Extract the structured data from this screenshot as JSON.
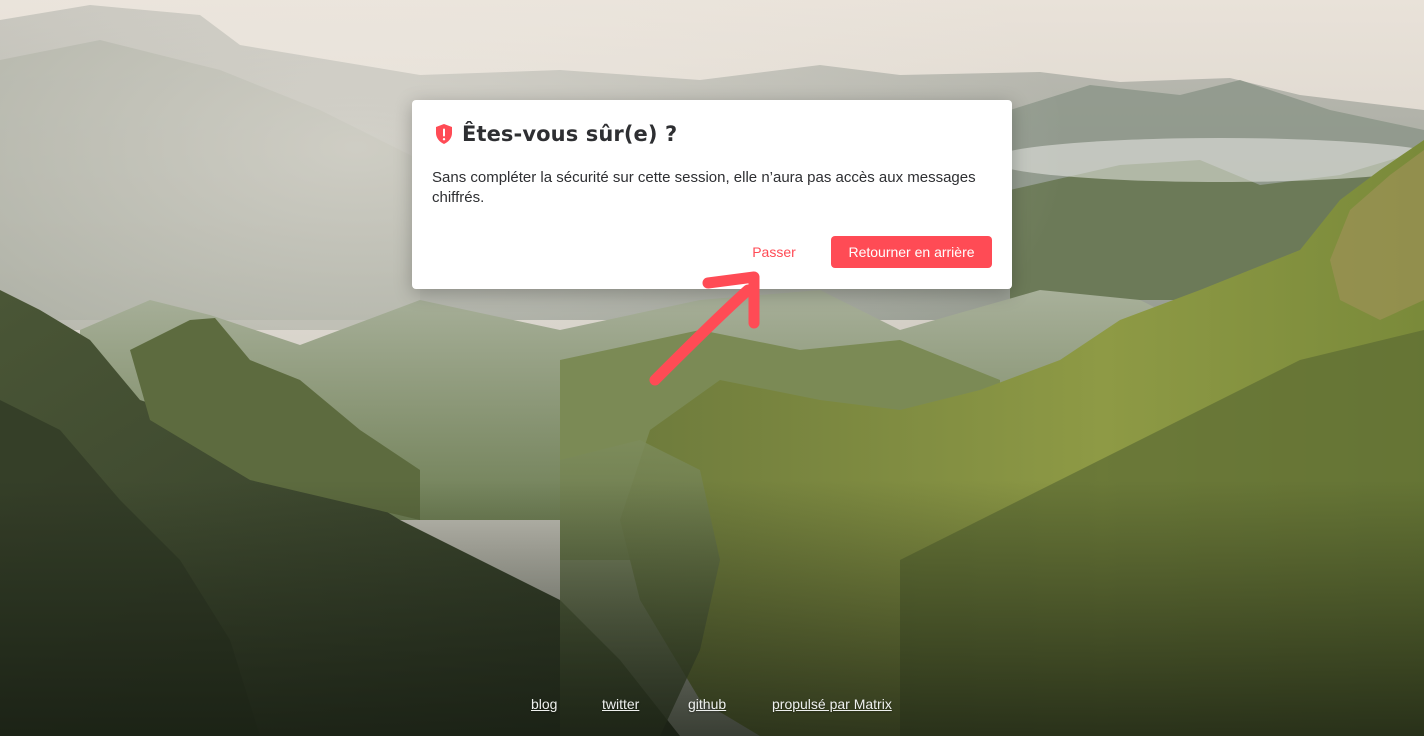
{
  "dialog": {
    "title": "Êtes-vous sûr(e) ?",
    "icon": "shield-warning-icon",
    "body": "Sans compléter la sécurité sur cette session, elle n’aura pas accès aux messages chiffrés.",
    "skip_label": "Passer",
    "back_label": "Retourner en arrière",
    "accent_color": "#ff4b55"
  },
  "annotation": {
    "icon": "red-arrow-annotation-icon",
    "color": "#ff4b55"
  },
  "footer": {
    "links": [
      {
        "label": "blog"
      },
      {
        "label": "twitter"
      },
      {
        "label": "github"
      },
      {
        "label": "propulsé par Matrix"
      }
    ]
  }
}
